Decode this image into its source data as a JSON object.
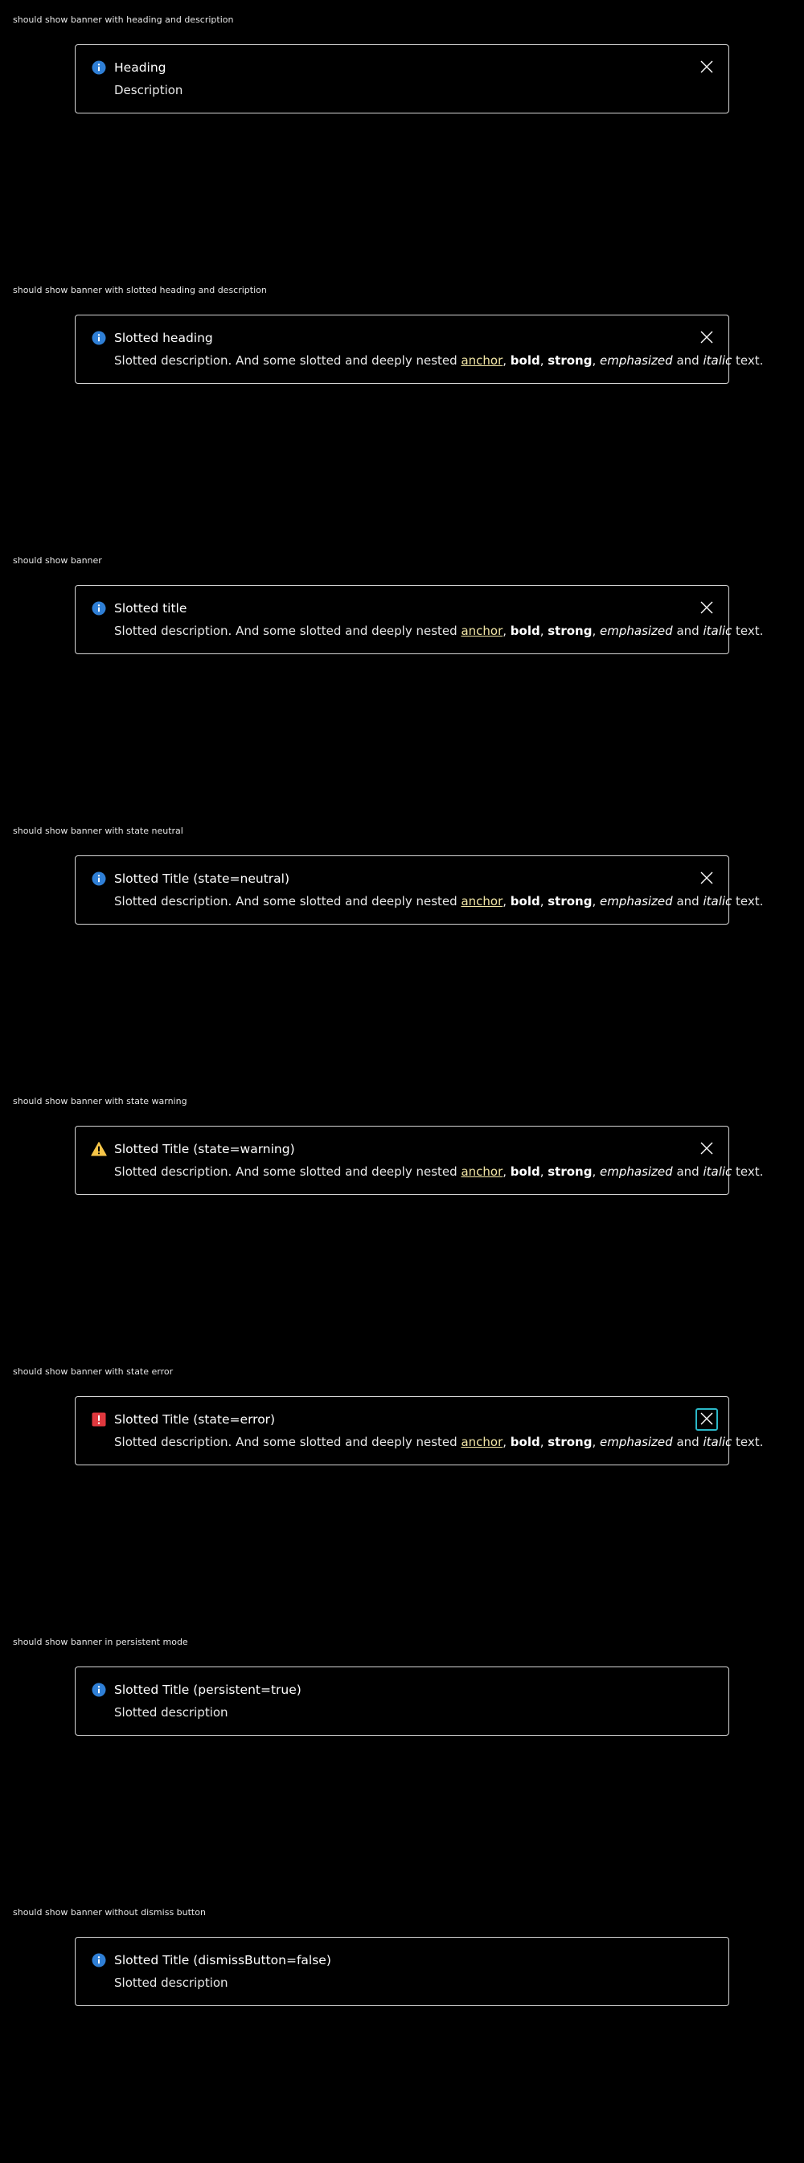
{
  "colors": {
    "background": "#000000",
    "border": "#d5d5d5",
    "info_icon": "#2f7fd6",
    "warning_icon": "#f6c548",
    "error_icon": "#e0383e",
    "anchor": "#f2e6a6",
    "focus_ring": "#2bb8c8"
  },
  "rich_description": {
    "intro": "Slotted description. And some slotted and deeply nested ",
    "anchor": "anchor",
    "sep1": ", ",
    "bold": "bold",
    "sep2": ", ",
    "strong": "strong",
    "sep3": ", ",
    "emphasized": "emphasized",
    "sep4": " and ",
    "italic": "italic",
    "outro": " text."
  },
  "sections": [
    {
      "label": "should show banner with heading and description",
      "banner": {
        "state": "info",
        "icon": "info-icon",
        "title": "Heading",
        "description": "Description",
        "dismiss_icon": "close-icon"
      }
    },
    {
      "label": "should show banner with slotted heading and description",
      "banner": {
        "state": "info",
        "icon": "info-icon",
        "title": "Slotted heading",
        "dismiss_icon": "close-icon"
      }
    },
    {
      "label": "should show banner",
      "banner": {
        "state": "info",
        "icon": "info-icon",
        "title": "Slotted title",
        "dismiss_icon": "close-icon"
      }
    },
    {
      "label": "should show banner with state neutral",
      "banner": {
        "state": "neutral",
        "icon": "info-icon",
        "title": "Slotted Title (state=neutral)",
        "dismiss_icon": "close-icon"
      }
    },
    {
      "label": "should show banner with state warning",
      "banner": {
        "state": "warning",
        "icon": "warning-icon",
        "title": "Slotted Title (state=warning)",
        "dismiss_icon": "close-icon"
      }
    },
    {
      "label": "should show banner with state error",
      "banner": {
        "state": "error",
        "icon": "error-icon",
        "title": "Slotted Title (state=error)",
        "dismiss_icon": "close-icon",
        "dismiss_focused": true
      }
    },
    {
      "label": "should show banner in persistent mode",
      "banner": {
        "state": "info",
        "icon": "info-icon",
        "title": "Slotted Title (persistent=true)",
        "description": "Slotted description"
      }
    },
    {
      "label": "should show banner without dismiss button",
      "banner": {
        "state": "info",
        "icon": "info-icon",
        "title": "Slotted Title (dismissButton=false)",
        "description": "Slotted description"
      }
    }
  ]
}
